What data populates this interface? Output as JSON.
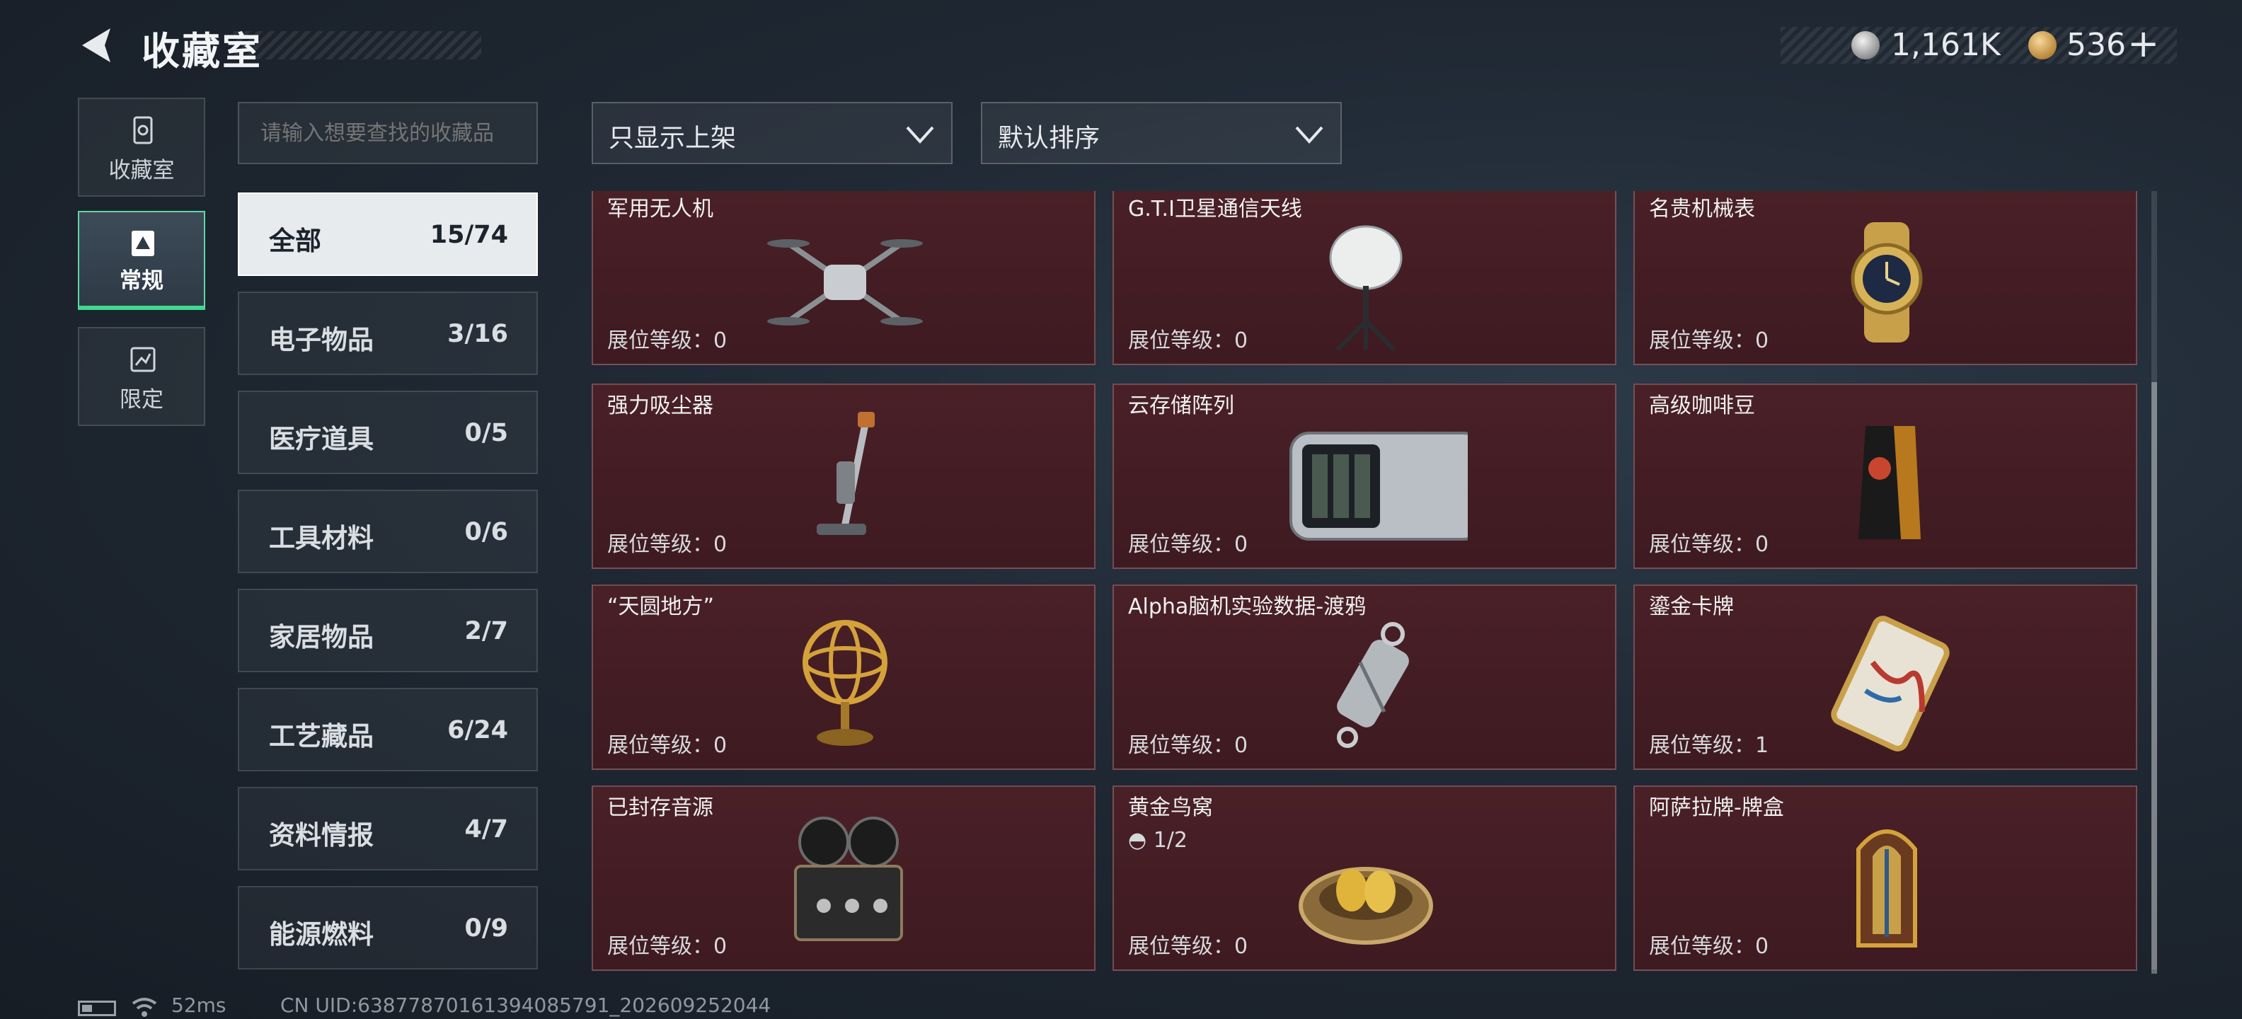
{
  "header": {
    "title": "收藏室",
    "silver_amount": "1,161K",
    "gold_amount": "536",
    "plus": "+"
  },
  "nav": [
    {
      "label": "收藏室",
      "icon": "vault-icon"
    },
    {
      "label": "常规",
      "icon": "regular-collection-icon"
    },
    {
      "label": "限定",
      "icon": "limited-collection-icon"
    }
  ],
  "search": {
    "placeholder": "请输入想要查找的收藏品"
  },
  "filters": {
    "shelf": "只显示上架",
    "sort": "默认排序"
  },
  "categories": [
    {
      "name": "全部",
      "count": "15/74"
    },
    {
      "name": "电子物品",
      "count": "3/16"
    },
    {
      "name": "医疗道具",
      "count": "0/5"
    },
    {
      "name": "工具材料",
      "count": "0/6"
    },
    {
      "name": "家居物品",
      "count": "2/7"
    },
    {
      "name": "工艺藏品",
      "count": "6/24"
    },
    {
      "name": "资料情报",
      "count": "4/7"
    },
    {
      "name": "能源燃料",
      "count": "0/9"
    }
  ],
  "items": [
    {
      "name": "军用无人机",
      "level": "展位等级：0",
      "icon": "drone-icon"
    },
    {
      "name": "G.T.I卫星通信天线",
      "level": "展位等级：0",
      "icon": "satellite-antenna-icon"
    },
    {
      "name": "名贵机械表",
      "level": "展位等级：0",
      "icon": "luxury-watch-icon"
    },
    {
      "name": "强力吸尘器",
      "level": "展位等级：0",
      "icon": "vacuum-cleaner-icon"
    },
    {
      "name": "云存储阵列",
      "level": "展位等级：0",
      "icon": "storage-array-icon"
    },
    {
      "name": "高级咖啡豆",
      "level": "展位等级：0",
      "icon": "coffee-bag-icon"
    },
    {
      "name": "“天圆地方”",
      "level": "展位等级：0",
      "icon": "armillary-sphere-icon"
    },
    {
      "name": "Alpha脑机实验数据-渡鸦",
      "level": "展位等级：0",
      "icon": "data-drive-icon"
    },
    {
      "name": "鎏金卡牌",
      "level": "展位等级：1",
      "icon": "gilded-card-icon"
    },
    {
      "name": "已封存音源",
      "level": "展位等级：0",
      "icon": "reel-recorder-icon"
    },
    {
      "name": "黄金鸟窝",
      "level": "展位等级：0",
      "progress": "1/2",
      "icon": "golden-nest-icon"
    },
    {
      "name": "阿萨拉牌-牌盒",
      "level": "展位等级：0",
      "icon": "card-box-icon"
    }
  ],
  "footer": {
    "ping": "52ms",
    "uid": "CN UID:6387787016139408579​1_202609252044"
  }
}
